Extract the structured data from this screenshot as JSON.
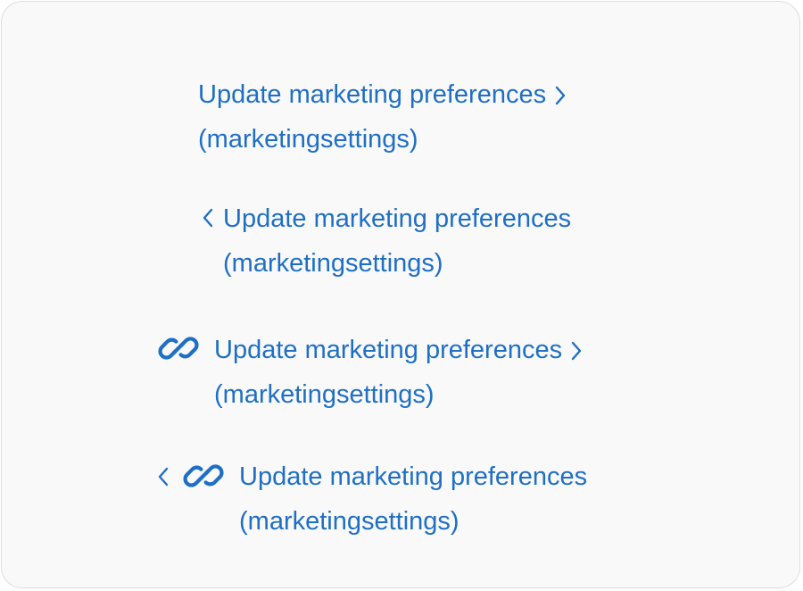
{
  "links": [
    {
      "title": "Update marketing preferences",
      "subtitle": "(marketingsettings)",
      "leading_chevron": false,
      "trailing_chevron": true,
      "link_icon": false
    },
    {
      "title": "Update marketing preferences",
      "subtitle": "(marketingsettings)",
      "leading_chevron": true,
      "trailing_chevron": false,
      "link_icon": false
    },
    {
      "title": "Update marketing preferences",
      "subtitle": "(marketingsettings)",
      "leading_chevron": false,
      "trailing_chevron": true,
      "link_icon": true
    },
    {
      "title": "Update marketing preferences",
      "subtitle": "(marketingsettings)",
      "leading_chevron": true,
      "trailing_chevron": false,
      "link_icon": true
    }
  ],
  "colors": {
    "link": "#1f6fc5",
    "card_background": "#f9f9f9",
    "card_border": "#dedede"
  },
  "icons": {
    "trailing": "chevron-right-icon",
    "leading": "chevron-left-icon",
    "link": "chain-link-icon"
  }
}
